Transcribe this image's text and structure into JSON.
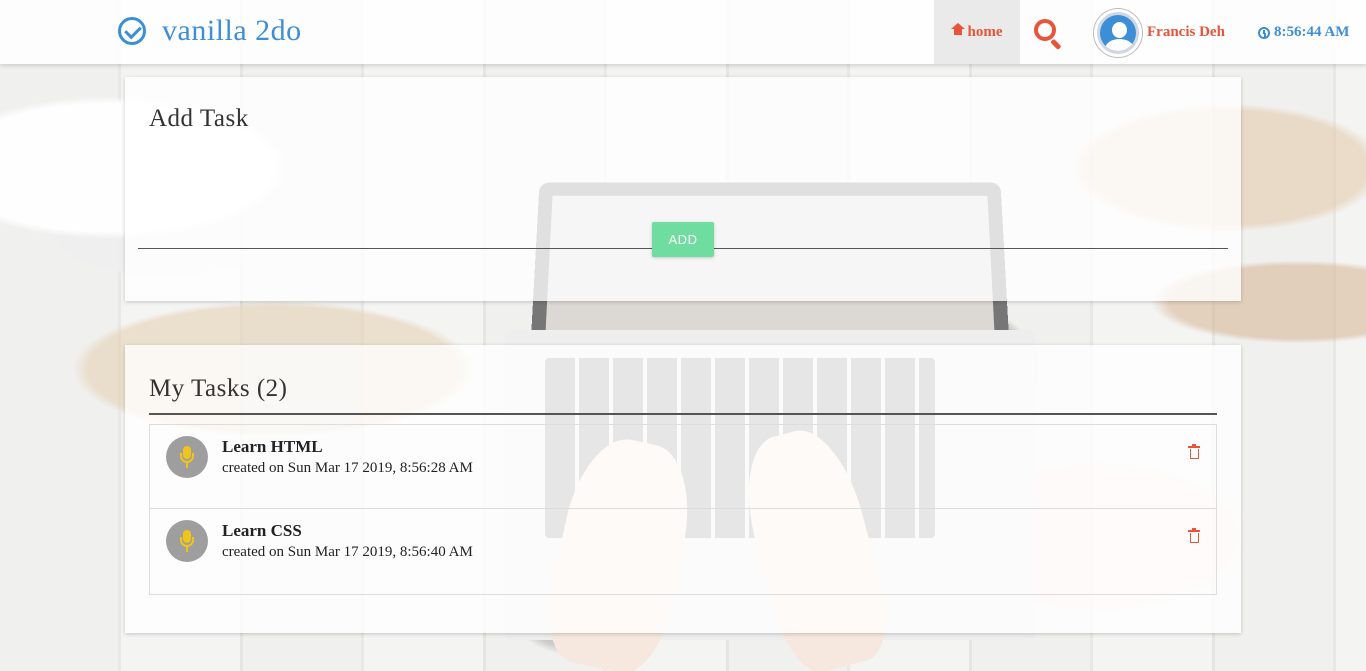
{
  "app": {
    "title": "vanilla 2do",
    "brand_color": "#3c8fd6",
    "accent_color": "#e8543a"
  },
  "navbar": {
    "home_label": "home",
    "user_name": "Francis Deh",
    "clock_time": "8:56:44 AM"
  },
  "add_task": {
    "heading": "Add Task",
    "input_value": "",
    "button_label": "ADD"
  },
  "my_tasks": {
    "heading": "My Tasks (2)",
    "items": [
      {
        "title": "Learn HTML",
        "created": "created on Sun Mar 17 2019, 8:56:28 AM"
      },
      {
        "title": "Learn CSS",
        "created": "created on Sun Mar 17 2019, 8:56:40 AM"
      }
    ]
  }
}
